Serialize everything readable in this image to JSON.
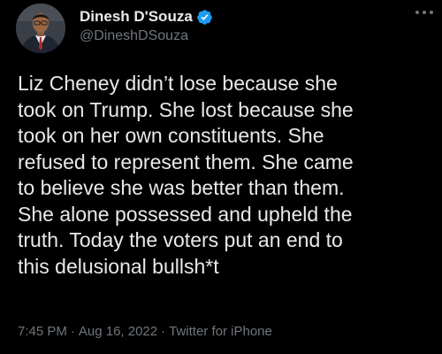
{
  "author": {
    "display_name": "Dinesh D'Souza",
    "handle": "@DineshDSouza",
    "verified": true,
    "verified_color": "#1d9bf0"
  },
  "tweet": {
    "text": "Liz Cheney didn’t lose because she\ntook on Trump. She lost because she\ntook on her own constituents. She\nrefused to represent them. She came\nto believe she was better than them.\nShe alone possessed and upheld the\ntruth. Today the voters put an end to\nthis delusional bullsh*t",
    "time": "7:45 PM",
    "date": "Aug 16, 2022",
    "source": "Twitter for iPhone",
    "separator": "·"
  },
  "icons": {
    "more": "more-horizontal-icon",
    "verified": "verified-badge-icon"
  },
  "colors": {
    "background": "#000000",
    "primary_text": "#e7e9ea",
    "secondary_text": "#71767b"
  }
}
